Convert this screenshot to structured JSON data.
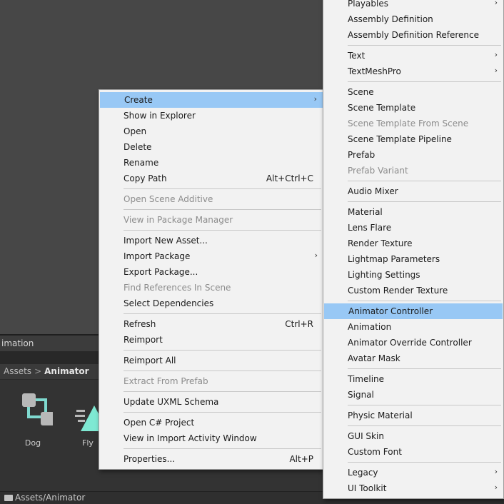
{
  "editor": {
    "animation_tab": "imation",
    "breadcrumb": {
      "root": "Assets",
      "separator": ">",
      "current": "Animator"
    },
    "assets": [
      {
        "label": "Dog",
        "icon": "animator-controller-icon"
      },
      {
        "label": "Fly",
        "icon": "animation-clip-icon"
      }
    ],
    "status_path": "Assets/Animator"
  },
  "context_menu": {
    "items": [
      {
        "type": "item",
        "label": "Create",
        "shortcut": "",
        "submenu": true,
        "highlighted": true,
        "disabled": false
      },
      {
        "type": "item",
        "label": "Show in Explorer",
        "shortcut": "",
        "submenu": false,
        "highlighted": false,
        "disabled": false
      },
      {
        "type": "item",
        "label": "Open",
        "shortcut": "",
        "submenu": false,
        "highlighted": false,
        "disabled": false
      },
      {
        "type": "item",
        "label": "Delete",
        "shortcut": "",
        "submenu": false,
        "highlighted": false,
        "disabled": false
      },
      {
        "type": "item",
        "label": "Rename",
        "shortcut": "",
        "submenu": false,
        "highlighted": false,
        "disabled": false
      },
      {
        "type": "item",
        "label": "Copy Path",
        "shortcut": "Alt+Ctrl+C",
        "submenu": false,
        "highlighted": false,
        "disabled": false
      },
      {
        "type": "separator"
      },
      {
        "type": "item",
        "label": "Open Scene Additive",
        "shortcut": "",
        "submenu": false,
        "highlighted": false,
        "disabled": true
      },
      {
        "type": "separator"
      },
      {
        "type": "item",
        "label": "View in Package Manager",
        "shortcut": "",
        "submenu": false,
        "highlighted": false,
        "disabled": true
      },
      {
        "type": "separator"
      },
      {
        "type": "item",
        "label": "Import New Asset...",
        "shortcut": "",
        "submenu": false,
        "highlighted": false,
        "disabled": false
      },
      {
        "type": "item",
        "label": "Import Package",
        "shortcut": "",
        "submenu": true,
        "highlighted": false,
        "disabled": false
      },
      {
        "type": "item",
        "label": "Export Package...",
        "shortcut": "",
        "submenu": false,
        "highlighted": false,
        "disabled": false
      },
      {
        "type": "item",
        "label": "Find References In Scene",
        "shortcut": "",
        "submenu": false,
        "highlighted": false,
        "disabled": true
      },
      {
        "type": "item",
        "label": "Select Dependencies",
        "shortcut": "",
        "submenu": false,
        "highlighted": false,
        "disabled": false
      },
      {
        "type": "separator"
      },
      {
        "type": "item",
        "label": "Refresh",
        "shortcut": "Ctrl+R",
        "submenu": false,
        "highlighted": false,
        "disabled": false
      },
      {
        "type": "item",
        "label": "Reimport",
        "shortcut": "",
        "submenu": false,
        "highlighted": false,
        "disabled": false
      },
      {
        "type": "separator"
      },
      {
        "type": "item",
        "label": "Reimport All",
        "shortcut": "",
        "submenu": false,
        "highlighted": false,
        "disabled": false
      },
      {
        "type": "separator"
      },
      {
        "type": "item",
        "label": "Extract From Prefab",
        "shortcut": "",
        "submenu": false,
        "highlighted": false,
        "disabled": true
      },
      {
        "type": "separator"
      },
      {
        "type": "item",
        "label": "Update UXML Schema",
        "shortcut": "",
        "submenu": false,
        "highlighted": false,
        "disabled": false
      },
      {
        "type": "separator"
      },
      {
        "type": "item",
        "label": "Open C# Project",
        "shortcut": "",
        "submenu": false,
        "highlighted": false,
        "disabled": false
      },
      {
        "type": "item",
        "label": "View in Import Activity Window",
        "shortcut": "",
        "submenu": false,
        "highlighted": false,
        "disabled": false
      },
      {
        "type": "separator"
      },
      {
        "type": "item",
        "label": "Properties...",
        "shortcut": "Alt+P",
        "submenu": false,
        "highlighted": false,
        "disabled": false
      }
    ]
  },
  "create_submenu": {
    "items": [
      {
        "type": "item",
        "label": "Playables",
        "submenu": true,
        "highlighted": false,
        "disabled": false
      },
      {
        "type": "item",
        "label": "Assembly Definition",
        "submenu": false,
        "highlighted": false,
        "disabled": false
      },
      {
        "type": "item",
        "label": "Assembly Definition Reference",
        "submenu": false,
        "highlighted": false,
        "disabled": false
      },
      {
        "type": "separator"
      },
      {
        "type": "item",
        "label": "Text",
        "submenu": true,
        "highlighted": false,
        "disabled": false
      },
      {
        "type": "item",
        "label": "TextMeshPro",
        "submenu": true,
        "highlighted": false,
        "disabled": false
      },
      {
        "type": "separator"
      },
      {
        "type": "item",
        "label": "Scene",
        "submenu": false,
        "highlighted": false,
        "disabled": false
      },
      {
        "type": "item",
        "label": "Scene Template",
        "submenu": false,
        "highlighted": false,
        "disabled": false
      },
      {
        "type": "item",
        "label": "Scene Template From Scene",
        "submenu": false,
        "highlighted": false,
        "disabled": true
      },
      {
        "type": "item",
        "label": "Scene Template Pipeline",
        "submenu": false,
        "highlighted": false,
        "disabled": false
      },
      {
        "type": "item",
        "label": "Prefab",
        "submenu": false,
        "highlighted": false,
        "disabled": false
      },
      {
        "type": "item",
        "label": "Prefab Variant",
        "submenu": false,
        "highlighted": false,
        "disabled": true
      },
      {
        "type": "separator"
      },
      {
        "type": "item",
        "label": "Audio Mixer",
        "submenu": false,
        "highlighted": false,
        "disabled": false
      },
      {
        "type": "separator"
      },
      {
        "type": "item",
        "label": "Material",
        "submenu": false,
        "highlighted": false,
        "disabled": false
      },
      {
        "type": "item",
        "label": "Lens Flare",
        "submenu": false,
        "highlighted": false,
        "disabled": false
      },
      {
        "type": "item",
        "label": "Render Texture",
        "submenu": false,
        "highlighted": false,
        "disabled": false
      },
      {
        "type": "item",
        "label": "Lightmap Parameters",
        "submenu": false,
        "highlighted": false,
        "disabled": false
      },
      {
        "type": "item",
        "label": "Lighting Settings",
        "submenu": false,
        "highlighted": false,
        "disabled": false
      },
      {
        "type": "item",
        "label": "Custom Render Texture",
        "submenu": false,
        "highlighted": false,
        "disabled": false
      },
      {
        "type": "separator"
      },
      {
        "type": "item",
        "label": "Animator Controller",
        "submenu": false,
        "highlighted": true,
        "disabled": false
      },
      {
        "type": "item",
        "label": "Animation",
        "submenu": false,
        "highlighted": false,
        "disabled": false
      },
      {
        "type": "item",
        "label": "Animator Override Controller",
        "submenu": false,
        "highlighted": false,
        "disabled": false
      },
      {
        "type": "item",
        "label": "Avatar Mask",
        "submenu": false,
        "highlighted": false,
        "disabled": false
      },
      {
        "type": "separator"
      },
      {
        "type": "item",
        "label": "Timeline",
        "submenu": false,
        "highlighted": false,
        "disabled": false
      },
      {
        "type": "item",
        "label": "Signal",
        "submenu": false,
        "highlighted": false,
        "disabled": false
      },
      {
        "type": "separator"
      },
      {
        "type": "item",
        "label": "Physic Material",
        "submenu": false,
        "highlighted": false,
        "disabled": false
      },
      {
        "type": "separator"
      },
      {
        "type": "item",
        "label": "GUI Skin",
        "submenu": false,
        "highlighted": false,
        "disabled": false
      },
      {
        "type": "item",
        "label": "Custom Font",
        "submenu": false,
        "highlighted": false,
        "disabled": false
      },
      {
        "type": "separator"
      },
      {
        "type": "item",
        "label": "Legacy",
        "submenu": true,
        "highlighted": false,
        "disabled": false
      },
      {
        "type": "item",
        "label": "UI Toolkit",
        "submenu": true,
        "highlighted": false,
        "disabled": false
      }
    ]
  }
}
